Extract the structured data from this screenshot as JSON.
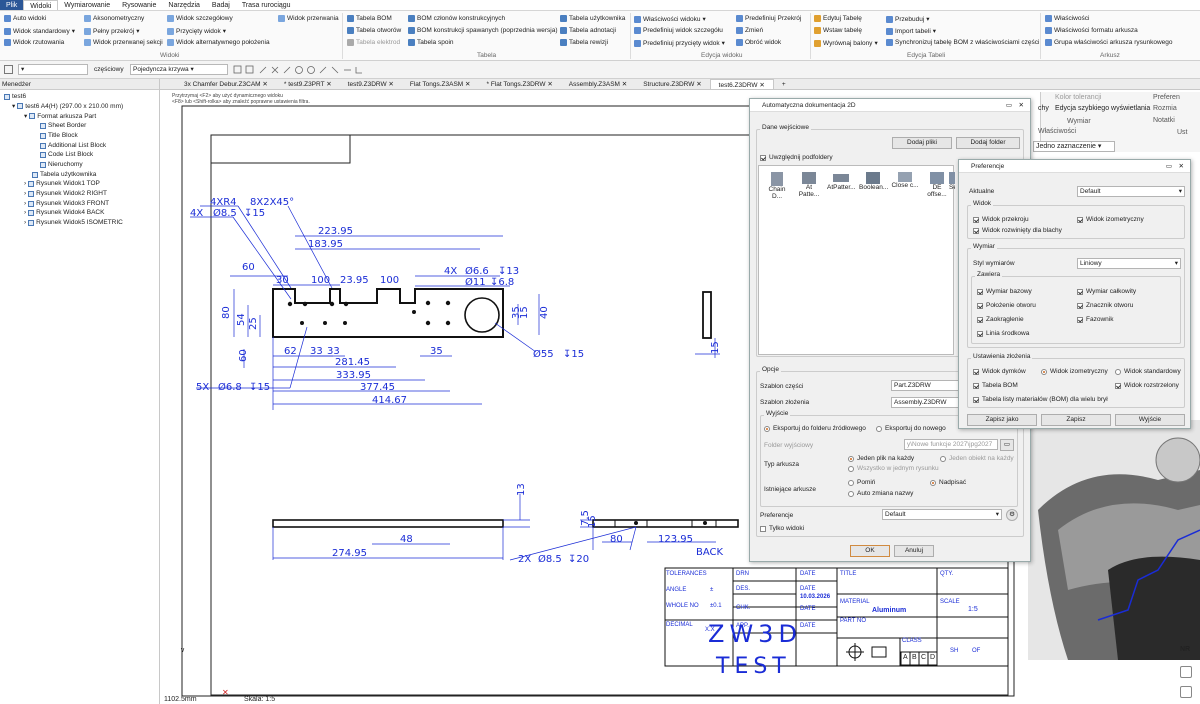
{
  "menubar": {
    "items": [
      "Plik",
      "Widoki",
      "Wymiarowanie",
      "Rysowanie",
      "Narzędzia",
      "Badaj",
      "Trasa rurociągu"
    ]
  },
  "ribbon": {
    "widoki": [
      "Auto widoki",
      "Widok standardowy",
      "Widok rzutowania",
      "Aksonometryczny",
      "Pełny przekrój",
      "Widok przerwanej sekcji",
      "Widok szczegółowy",
      "Przycięty widok",
      "Widok alternatywnego położenia",
      "Widok przerwania"
    ],
    "tabela": [
      "Tabela BOM",
      "Tabela otworów",
      "Tabela elektrod",
      "BOM członów konstrukcyjnych",
      "BOM konstrukcji spawanych (poprzednia wersja)",
      "Tabela spoin",
      "Tabela użytkownika",
      "Tabela adnotacji",
      "Tabela rewizji"
    ],
    "edycja_widoku": [
      "Właściwości widoku",
      "Predefiniuj widok szczegółu",
      "Predefiniuj przycięty widok",
      "Predefiniuj Przekrój",
      "Zmień",
      "Obróć widok"
    ],
    "edycja_tabeli": [
      "Edytuj Tabelę",
      "Wstaw tabelę",
      "Wyrównaj balony",
      "Przebuduj",
      "Import tabeli",
      "Synchronizuj tabelę BOM z właściwościami części"
    ],
    "arkusz": [
      "Właściwości",
      "Właściwości formatu arkusza",
      "Grupa właściwości arkusza rysunkowego"
    ],
    "groups": [
      "Widoki",
      "Tabela",
      "Edycja widoku",
      "Edycja Tabeli",
      "Arkusz"
    ]
  },
  "toolbar": {
    "filter_label": "częściowy",
    "curve_combo": "Pojedyncza krzywa"
  },
  "tabs": [
    "3x Chamfer Debur.Z3CAM",
    "* test9.Z3PRT",
    "test9.Z3DRW",
    "Flat Tongs.Z3ASM",
    "* Flat Tongs.Z3DRW",
    "Assembly.Z3ASM",
    "Structure.Z3DRW",
    "test6.Z3DRW"
  ],
  "manager": {
    "header": "Menedżer",
    "items": [
      "test6",
      "test6 A4(H) (297.00 x 210.00 mm)",
      "Format arkusza Part",
      "Sheet Border",
      "Title Block",
      "Additional List Block",
      "Code List Block",
      "Nieruchomy",
      "Tabela użytkownika",
      "Rysunek Widok1 TOP",
      "Rysunek Widok2 RIGHT",
      "Rysunek Widok3 FRONT",
      "Rysunek Widok4 BACK",
      "Rysunek Widok5 ISOMETRIC"
    ]
  },
  "canvas": {
    "hint1": "Przytrzymaj <F2> aby użyć dynamicznego widoku",
    "hint2": "<F8> lub <Shift-rolka> aby znaleźć poprawne ustawienia filtra.",
    "status_len": "1102.5mm",
    "status_scale": "Skala: 1:5",
    "dims": {
      "t1": "4XR4",
      "t2": "8X2X45°",
      "t3": "4X",
      "t4": "Ø8.5",
      "t5": "↧15",
      "t6": "223.95",
      "t7": "183.95",
      "t8": "60",
      "t9": "30",
      "t10": "100",
      "t11": "23.95",
      "t12": "100",
      "t13": "4X",
      "t14": "Ø6.6",
      "t15": "↧13",
      "t16": "Ø11",
      "t17": "↧6.8",
      "t18": "80",
      "t19": "54",
      "t20": "25",
      "t21": "15",
      "t22": "35",
      "t23": "40",
      "t24": "60",
      "t25": "62",
      "t26": "33",
      "t27": "33",
      "t28": "35",
      "t29": "281.45",
      "t30": "333.95",
      "t31": "Ø55",
      "t32": "↧15",
      "t33": "5X",
      "t34": "Ø6.8",
      "t35": "↧15",
      "t36": "377.45",
      "t37": "414.67",
      "t38": "13",
      "t39": "48",
      "t40": "274.95",
      "t41": "2X",
      "t42": "Ø8.5",
      "t43": "↧20",
      "t44": "7.5",
      "t45": "15",
      "t46": "80",
      "t47": "123.95",
      "t48": "BACK",
      "t49": "15"
    },
    "titleblock": {
      "tolerances": "TOLERANCES",
      "angle": "ANGLE",
      "angle_v": "±",
      "whole": "WHOLE NO",
      "whole_v": "±0.1",
      "decimal": "DECIMAL",
      "decimal_v": "X.X",
      "drn": "DRN",
      "des": "DES.",
      "chk": "CHK.",
      "appr": "APP.",
      "date": "DATE",
      "date2": "DATE",
      "date_v": "10.03.2026",
      "date3": "DATE",
      "date4": "DATE",
      "title": "TITLE",
      "qty": "QTY.",
      "material": "MATERIAL",
      "material_v": "Aluminum",
      "scale": "SCALE",
      "scale_v": "1:5",
      "partno": "PART NO",
      "zw3d": "ZW3D",
      "test": "TEST",
      "class": "CLASS",
      "sh": "SH",
      "of": "OF",
      "a": "A",
      "b": "B",
      "c": "C",
      "d": "D"
    }
  },
  "dialog_auto": {
    "title": "Automatyczna dokumentacja 2D",
    "input_label": "Dane wejściowe",
    "add_files": "Dodaj pliki",
    "add_folder": "Dodaj folder",
    "subfolders": "Uwzględnij podfoldery",
    "files": [
      "Chain D...",
      "At Patte...",
      "AtPatter...",
      "Boolean...",
      "Close c...",
      "DE offse...",
      "Se"
    ],
    "options": "Opcje",
    "part_tpl_label": "Szablon części",
    "part_tpl": "Part.Z3DRW",
    "asm_tpl_label": "Szablon złożenia",
    "asm_tpl": "Assembly.Z3DRW",
    "output": "Wyjście",
    "export_src": "Eksportuj do folderu źródłowego",
    "export_new": "Eksportuj do nowego",
    "out_folder_label": "Folder wyjściowy",
    "out_folder": "y\\Nowe funkcje 2027\\jpg2027",
    "sheet_type": "Typ arkusza",
    "one_each": "Jeden plik na każdy",
    "one_obj": "Jeden obiekt na każdy",
    "all_one": "Wszystko w jednym rysunku",
    "existing": "Istniejące arkusze",
    "skip": "Pomiń",
    "overwrite": "Nadpisać",
    "auto_change": "Auto zmiana nazwy",
    "pref_label": "Preferencje",
    "pref_val": "Default",
    "views_only": "Tylko widoki",
    "ok": "OK",
    "cancel": "Anuluj"
  },
  "dialog_pref": {
    "title": "Preferencje",
    "current_label": "Aktualne",
    "current": "Default",
    "view": "Widok",
    "v1": "Widok przekroju",
    "v2": "Widok izometryczny",
    "v3": "Widok rozwinięty dla blachy",
    "dim": "Wymiar",
    "dim_style_label": "Styl wymiarów",
    "dim_style": "Liniowy",
    "contains": "Zawiera",
    "c1": "Wymiar bazowy",
    "c2": "Wymiar całkowity",
    "c3": "Położenie otworu",
    "c4": "Znacznik otworu",
    "c5": "Zaokrąglenie",
    "c6": "Fazownik",
    "c7": "Linia środkowa",
    "asm": "Ustawienia złożenia",
    "a1": "Widok dymków",
    "a2": "Widok izometryczny",
    "a3": "Widok standardowy",
    "a4": "Tabela BOM",
    "a5": "Widok rozstrzelony",
    "a6": "Tabela listy materiałów (BOM) dla wielu brył",
    "save_as": "Zapisz jako",
    "save": "Zapisz",
    "exit": "Wyjście"
  },
  "right_panel": {
    "items": [
      "Kolor tolerancji",
      "Edycja szybkiego wyświetlania",
      "Wymiar",
      "Właściwości",
      "Preferen",
      "Rozmia",
      "Notatki",
      "Ust",
      "Jedno zaznaczenie",
      "chy"
    ]
  },
  "colors": {
    "accent": "#2b5797",
    "dim": "#1a2cd6",
    "orange": "#d06a20"
  }
}
